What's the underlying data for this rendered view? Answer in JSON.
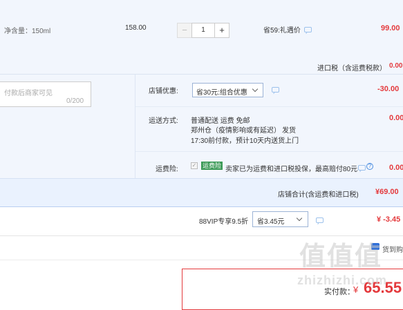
{
  "product": {
    "spec": "净含量：150ml",
    "price": "158.00",
    "quantity": "1",
    "minus": "−",
    "plus": "+",
    "promo_text": "省59:礼遇价",
    "subtotal": "99.00"
  },
  "import_tax": {
    "label": "进口税（含运费税款）",
    "value": "0.00"
  },
  "remark": {
    "placeholder": "付款后商家可见",
    "counter": "0/200"
  },
  "shop_discount": {
    "label": "店铺优惠:",
    "selected": "省30元:组合优惠",
    "value": "-30.00"
  },
  "shipping": {
    "label": "运送方式:",
    "line1": "普通配送 运费 免邮",
    "line2a": "郑州仓（疫情影响或有延迟）",
    "line2b": "发货",
    "line3": "17:30前付款，预计10天内送货上门",
    "value": "0.00"
  },
  "insurance": {
    "label": "运费险:",
    "badge": "运费险",
    "text": "卖家已为运费和进口税投保，最高赔付80元",
    "value": "0.00"
  },
  "shop_total": {
    "label": "店铺合计(含运费和进口税)",
    "value": "¥69.00"
  },
  "vip": {
    "label": "88VIP专享9.5折",
    "selected": "省3.45元",
    "value": "¥ -3.45"
  },
  "footer": {
    "link_fragment": "货到购",
    "pay_label": "实付款：",
    "currency": "¥",
    "pay_amount": "65.55"
  },
  "watermark": {
    "glyphs": "值值值",
    "domain": "zhizhizhi.com"
  },
  "colors": {
    "accent_red": "#e4393c",
    "band_bg": "#f2f6fd",
    "border_blue": "#b9cef0"
  }
}
